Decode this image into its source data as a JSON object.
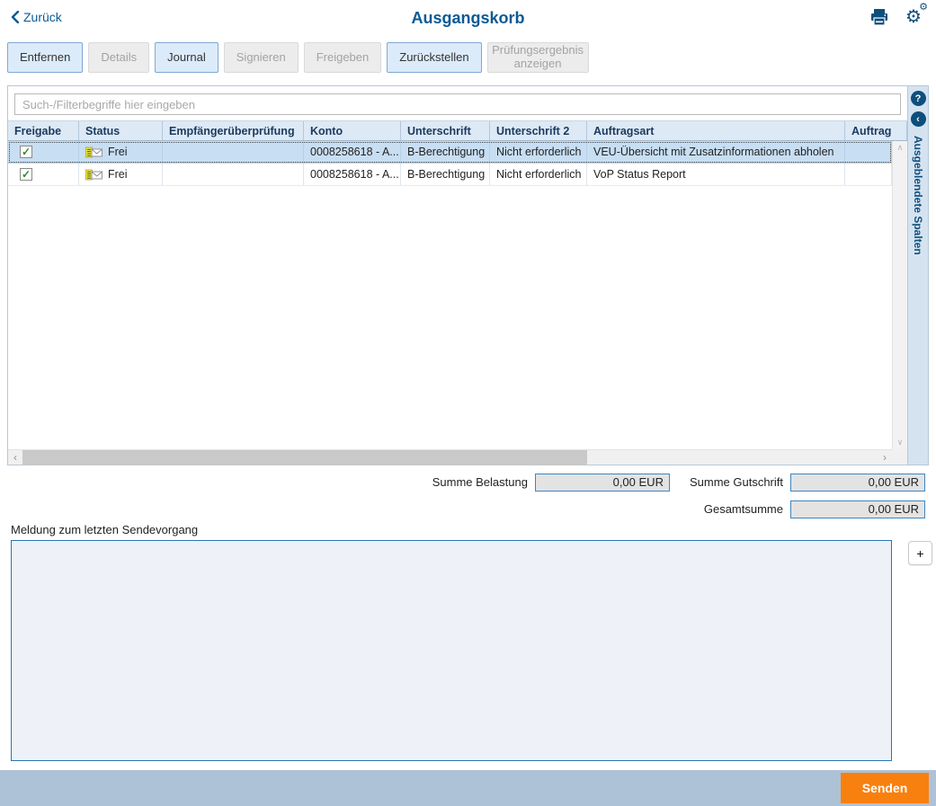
{
  "header": {
    "back_label": "Zurück",
    "title": "Ausgangskorb"
  },
  "toolbar": {
    "buttons": [
      {
        "label": "Entfernen",
        "enabled": true
      },
      {
        "label": "Details",
        "enabled": false
      },
      {
        "label": "Journal",
        "enabled": true
      },
      {
        "label": "Signieren",
        "enabled": false
      },
      {
        "label": "Freigeben",
        "enabled": false
      },
      {
        "label": "Zurückstellen",
        "enabled": true
      },
      {
        "label": "Prüfungsergebnis anzeigen",
        "enabled": false
      }
    ]
  },
  "search": {
    "placeholder": "Such-/Filterbegriffe hier eingeben"
  },
  "table": {
    "columns": [
      {
        "label": "Freigabe"
      },
      {
        "label": "Status"
      },
      {
        "label": "Empfängerüberprüfung"
      },
      {
        "label": "Konto"
      },
      {
        "label": "Unterschrift"
      },
      {
        "label": "Unterschrift 2"
      },
      {
        "label": "Auftragsart"
      },
      {
        "label": "Auftrag"
      }
    ],
    "rows": [
      {
        "freigabe_checked": true,
        "status": "Frei",
        "empfaengerueberpruefung": "",
        "konto": "0008258618 - A...",
        "unterschrift": "B-Berechtigung",
        "unterschrift2": "Nicht erforderlich",
        "auftragsart": "VEU-Übersicht mit Zusatzinformationen abholen",
        "selected": true
      },
      {
        "freigabe_checked": true,
        "status": "Frei",
        "empfaengerueberpruefung": "",
        "konto": "0008258618 - A...",
        "unterschrift": "B-Berechtigung",
        "unterschrift2": "Nicht erforderlich",
        "auftragsart": "VoP Status Report",
        "selected": false
      }
    ]
  },
  "hidden_columns": {
    "label": "Ausgeblendete Spalten",
    "help_glyph": "?",
    "collapse_glyph": "‹"
  },
  "totals": {
    "debit_label": "Summe Belastung",
    "debit_value": "0,00 EUR",
    "credit_label": "Summe Gutschrift",
    "credit_value": "0,00 EUR",
    "total_label": "Gesamtsumme",
    "total_value": "0,00 EUR"
  },
  "message": {
    "label": "Meldung zum letzten Sendevorgang",
    "value": "",
    "expand_glyph": "+"
  },
  "footer": {
    "send_label": "Senden"
  },
  "colors": {
    "accent_blue": "#0a5a94",
    "icon_blue": "#0d4f7c",
    "button_enabled_bg": "#dcebfa",
    "selected_row_bg": "#c8def2",
    "send_orange": "#f8800f",
    "footer_bar": "#aec2d7"
  }
}
